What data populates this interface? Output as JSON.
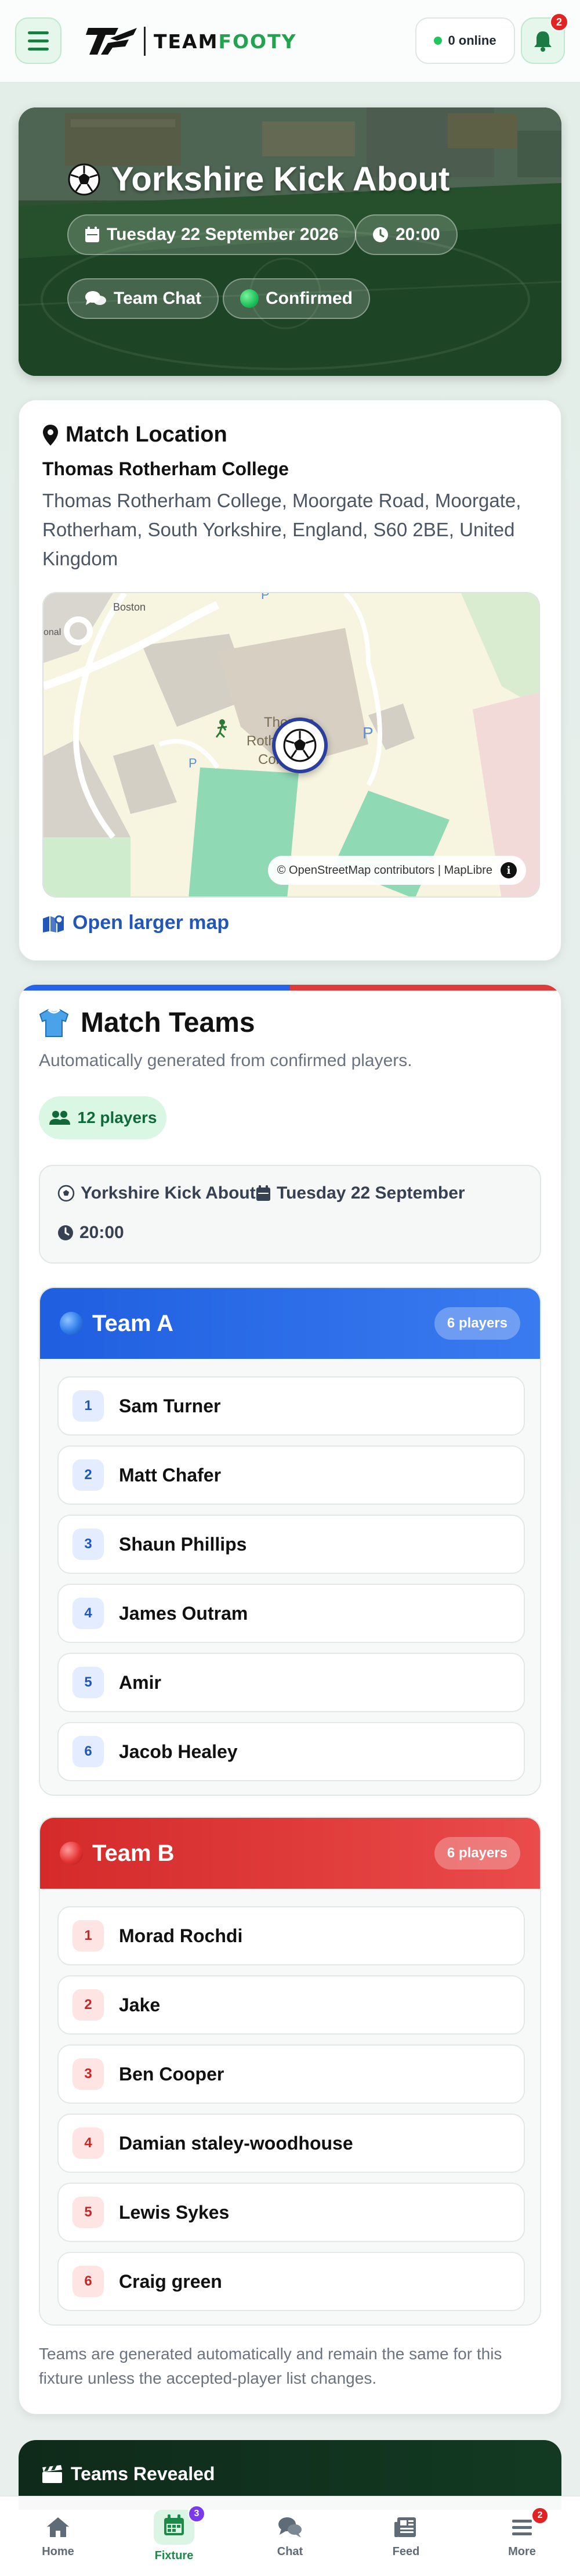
{
  "header": {
    "brand_prefix": "TEAM",
    "brand_suffix": "FOOTY",
    "online_label": "0 online",
    "notifications_count": "2"
  },
  "hero": {
    "title": "Yorkshire Kick About",
    "date": "Tuesday 22 September 2026",
    "time": "20:00",
    "chat_label": "Team Chat",
    "status_label": "Confirmed"
  },
  "location": {
    "heading": "Match Location",
    "venue_name": "Thomas Rotherham College",
    "address": "Thomas Rotherham College, Moorgate Road, Moorgate, Rotherham, South Yorkshire, England, S60 2BE, United Kingdom",
    "map_attribution": "© OpenStreetMap contributors | MapLibre",
    "map_info_glyph": "i",
    "map_labels": [
      "Boston",
      "onal",
      "Thomas",
      "Rotherham",
      "College"
    ],
    "open_map_label": "Open larger map"
  },
  "teams": {
    "heading": "Match Teams",
    "subtitle": "Automatically generated from confirmed players.",
    "players_total": "12 players",
    "fixture_name": "Yorkshire Kick About",
    "fixture_date": "Tuesday 22 September",
    "fixture_time": "20:00",
    "team_a": {
      "name": "Team A",
      "count": "6 players",
      "players": [
        {
          "num": "1",
          "name": "Sam Turner"
        },
        {
          "num": "2",
          "name": "Matt Chafer"
        },
        {
          "num": "3",
          "name": "Shaun Phillips"
        },
        {
          "num": "4",
          "name": "James Outram"
        },
        {
          "num": "5",
          "name": "Amir"
        },
        {
          "num": "6",
          "name": "Jacob Healey"
        }
      ]
    },
    "team_b": {
      "name": "Team B",
      "count": "6 players",
      "players": [
        {
          "num": "1",
          "name": "Morad Rochdi"
        },
        {
          "num": "2",
          "name": "Jake"
        },
        {
          "num": "3",
          "name": "Ben Cooper"
        },
        {
          "num": "4",
          "name": "Damian staley-woodhouse"
        },
        {
          "num": "5",
          "name": "Lewis Sykes"
        },
        {
          "num": "6",
          "name": "Craig green"
        }
      ]
    },
    "note": "Teams are generated automatically and remain the same for this fixture unless the accepted-player list changes."
  },
  "revealed": {
    "title": "Teams Revealed"
  },
  "bottom_nav": {
    "items": [
      {
        "label": "Home",
        "badge": ""
      },
      {
        "label": "Fixture",
        "badge": "3"
      },
      {
        "label": "Chat",
        "badge": ""
      },
      {
        "label": "Feed",
        "badge": ""
      },
      {
        "label": "More",
        "badge": "2"
      }
    ],
    "active": "Fixture"
  },
  "colors": {
    "brand_green": "#22a34f",
    "team_a_blue": "#2563eb",
    "team_b_red": "#e03b3b",
    "link_blue": "#2257b8",
    "badge_red": "#e02424",
    "fixture_badge_purple": "#7c3aed"
  }
}
